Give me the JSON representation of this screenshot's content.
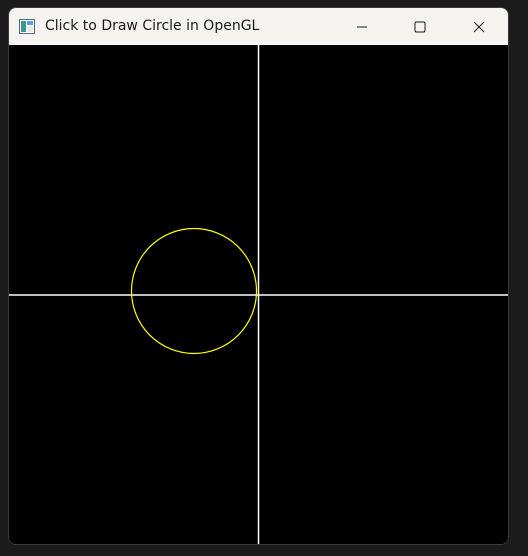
{
  "window": {
    "title": "Click to Draw Circle in OpenGL"
  },
  "icons": {
    "app": "opengl-app-icon",
    "minimize": "minimize-icon",
    "maximize": "maximize-icon",
    "close": "close-icon"
  },
  "colors": {
    "canvas_background": "#000000",
    "axes": "#ffffff",
    "circle": "#ffff00",
    "titlebar": "#f5f3ef"
  }
}
